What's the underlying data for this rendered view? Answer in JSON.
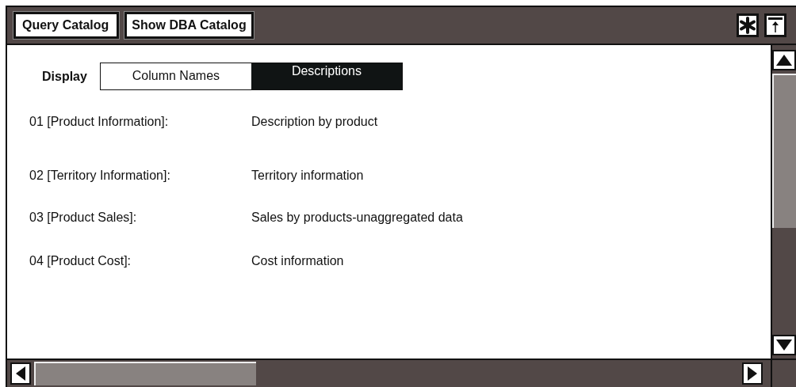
{
  "toolbar": {
    "buttons": [
      "Query Catalog",
      "Show DBA Catalog"
    ]
  },
  "display": {
    "label": "Display",
    "options": [
      {
        "label": "Column Names",
        "selected": false
      },
      {
        "label": "Descriptions",
        "selected": true
      }
    ]
  },
  "entries": [
    {
      "name": "01 [Product Information]:",
      "description": "Description by product"
    },
    {
      "name": "02 [Territory Information]:",
      "description": "Territory information"
    },
    {
      "name": "03 [Product Sales]:",
      "description": "Sales by products-unaggregated data"
    },
    {
      "name": "04 [Product Cost]:",
      "description": "Cost information"
    }
  ]
}
